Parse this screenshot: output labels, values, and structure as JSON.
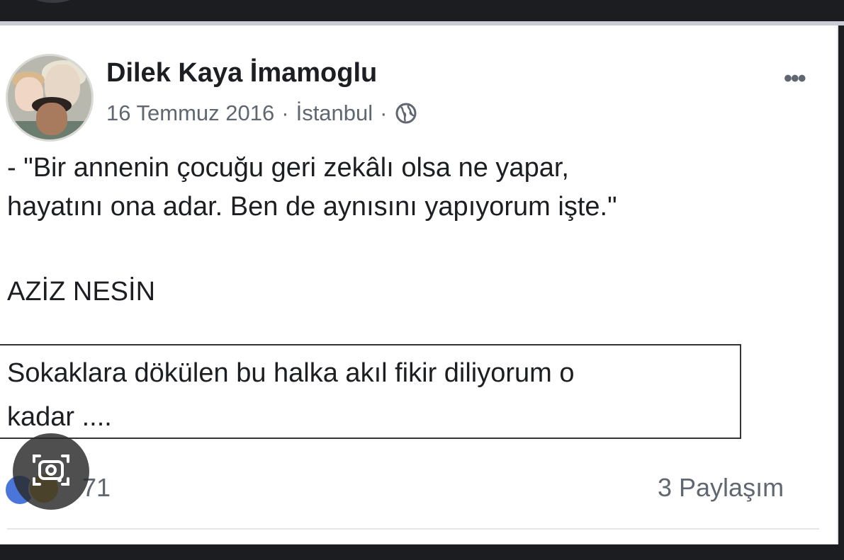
{
  "post": {
    "author": "Dilek Kaya İmamoglu",
    "date": "16 Temmuz 2016",
    "location": "İstanbul",
    "separator": "·",
    "more_label": "•••",
    "audience_icon": "globe-icon",
    "body_line1": "- \"Bir annenin çocuğu geri zekâlı olsa ne yapar,",
    "body_line2": "hayatını ona adar. Ben de aynısını yapıyorum işte.\"",
    "signature": "AZİZ NESİN",
    "comment_line1": "Sokaklara dökülen bu halka akıl fikir diliyorum o",
    "comment_line2": "kadar ....",
    "reaction_count": "71",
    "shares": "3 Paylaşım",
    "reaction_icons": [
      "like-reaction-icon",
      "haha-reaction-icon"
    ]
  },
  "overlay": {
    "icon": "camera-search-icon"
  },
  "colors": {
    "background_dark": "#1c1d21",
    "card": "#ffffff",
    "text_primary": "#1c1e21",
    "text_secondary": "#606770",
    "like_blue": "#4a76d9",
    "haha_yellow": "#e9b53e"
  }
}
